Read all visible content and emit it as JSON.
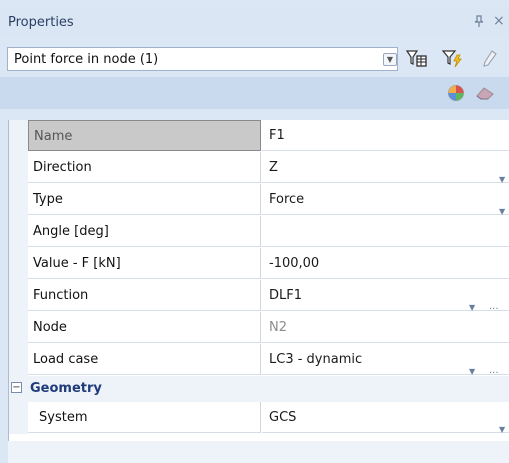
{
  "panel": {
    "title": "Properties",
    "pin_glyph": "ᵖ",
    "close_glyph": "×"
  },
  "object_selector": {
    "value": "Point force in node (1)"
  },
  "toolbar_icons": [
    "filter-table-icon",
    "filter-lightning-icon",
    "pencil-icon",
    "color-palette-icon",
    "eraser-icon"
  ],
  "properties": [
    {
      "name": "Name",
      "value": "F1",
      "selected": true
    },
    {
      "name": "Direction",
      "value": "Z",
      "dropdown": true
    },
    {
      "name": "Type",
      "value": "Force",
      "dropdown": true
    },
    {
      "name": "Angle [deg]",
      "value": ""
    },
    {
      "name": "Value - F [kN]",
      "value": "-100,00"
    },
    {
      "name": "Function",
      "value": "DLF1",
      "dropdown": true,
      "ellipsis": true
    },
    {
      "name": "Node",
      "value": "N2",
      "readonly": true
    },
    {
      "name": "Load case",
      "value": "LC3 - dynamic",
      "dropdown": true,
      "ellipsis": true
    }
  ],
  "category": {
    "toggle": "−",
    "label": "Geometry",
    "properties": [
      {
        "name": "System",
        "value": "GCS",
        "dropdown": true
      }
    ]
  },
  "ellipsis_text": "...",
  "dropdown_glyph": "▼"
}
